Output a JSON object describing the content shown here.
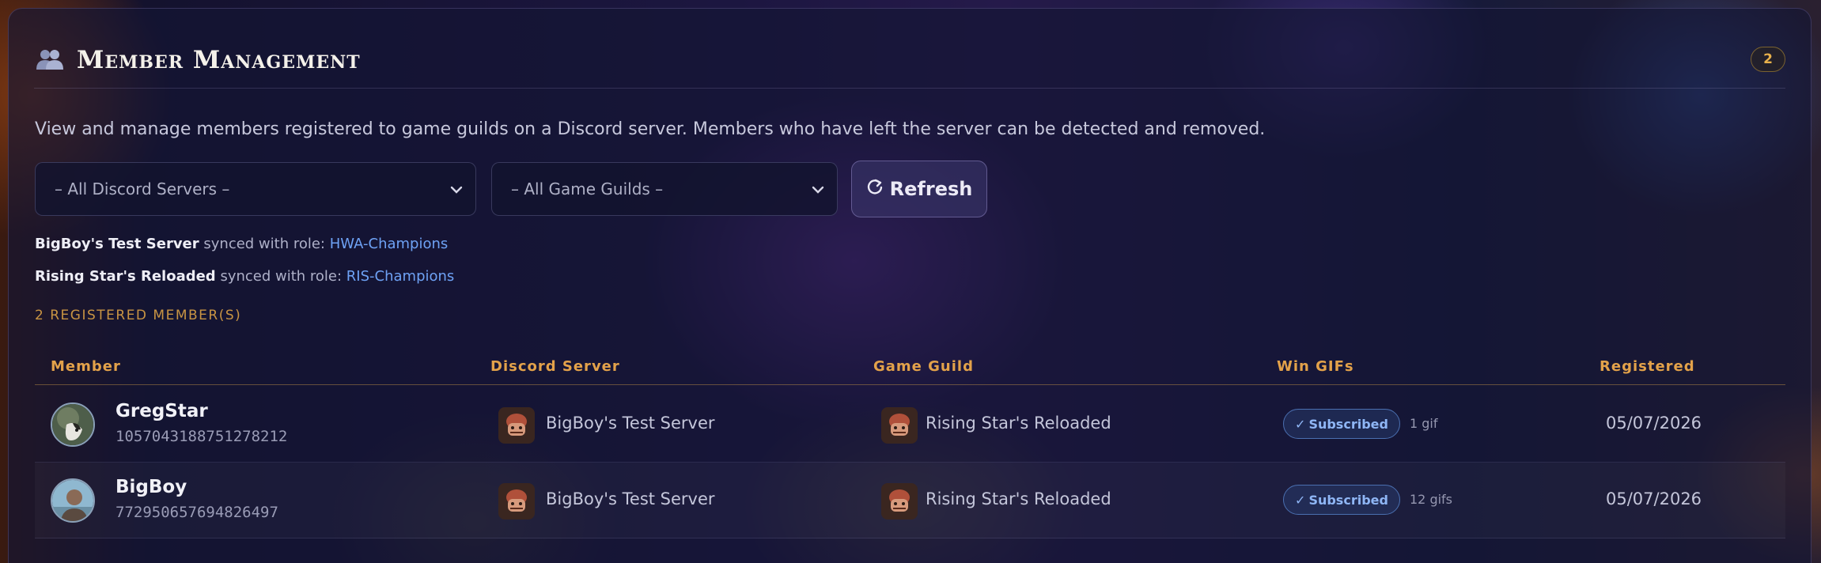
{
  "header": {
    "title": "Member Management",
    "count": "2"
  },
  "description": "View and manage members registered to game guilds on a Discord server. Members who have left the server can be detected and removed.",
  "filters": {
    "server_select": "– All Discord Servers –",
    "guild_select": "– All Game Guilds –",
    "refresh_label": "Refresh"
  },
  "sync_info": [
    {
      "server": "BigBoy's Test Server",
      "text": "synced with role:",
      "role": "HWA-Champions"
    },
    {
      "server": "Rising Star's Reloaded",
      "text": "synced with role:",
      "role": "RIS-Champions"
    }
  ],
  "registered_count": "2 REGISTERED MEMBER(S)",
  "table": {
    "headers": [
      "Member",
      "Discord Server",
      "Game Guild",
      "Win GIFs",
      "Registered"
    ],
    "rows": [
      {
        "name": "GregStar",
        "id": "1057043188751278212",
        "server": "BigBoy's Test Server",
        "guild": "Rising Star's Reloaded",
        "status": "Subscribed",
        "gifs": "1 gif",
        "date": "05/07/2026"
      },
      {
        "name": "BigBoy",
        "id": "772950657694826497",
        "server": "BigBoy's Test Server",
        "guild": "Rising Star's Reloaded",
        "status": "Subscribed",
        "gifs": "12 gifs",
        "date": "05/07/2026"
      }
    ]
  },
  "colors": {
    "accent_gold": "#e3a24a",
    "role_link": "#6ea2f5",
    "subscribed": "#8fb6f5"
  },
  "icons": {
    "header": "members-icon",
    "refresh": "refresh-icon",
    "select": "chevron-down-icon",
    "subscribed": "checkmark-icon"
  }
}
